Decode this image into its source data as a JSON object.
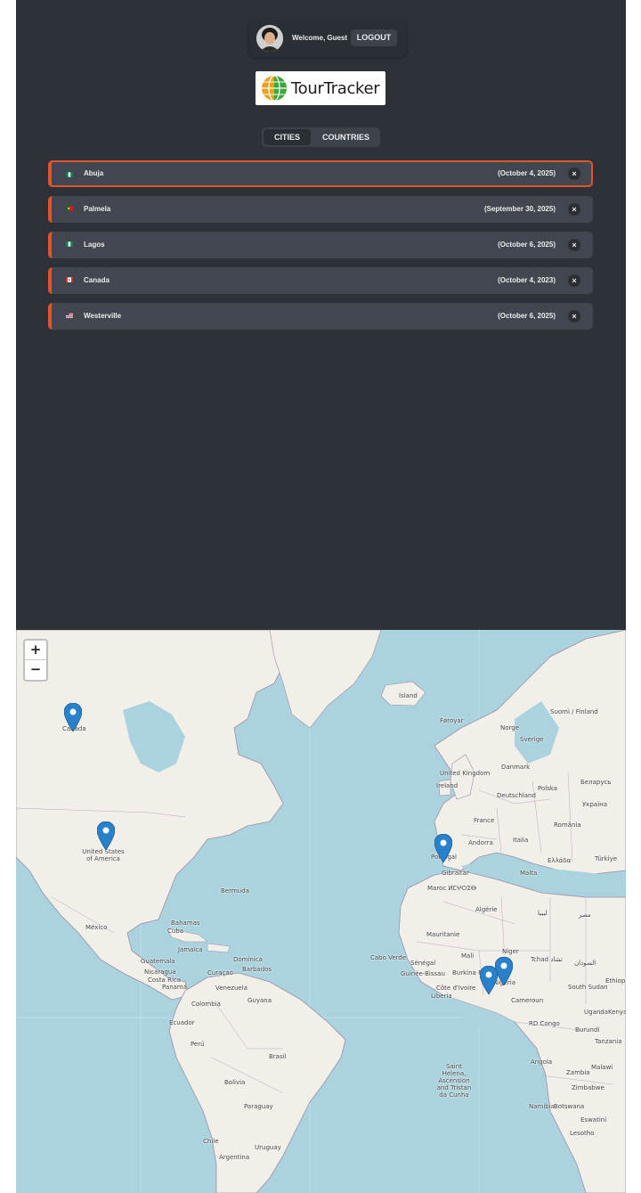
{
  "header": {
    "welcome": "Welcome, Guest",
    "logout_label": "LOGOUT"
  },
  "logo": {
    "text": "TourTracker"
  },
  "tabs": [
    {
      "label": "CITIES",
      "active": true
    },
    {
      "label": "COUNTRIES",
      "active": false
    }
  ],
  "cities": [
    {
      "name": "Abuja",
      "date": "(October 4, 2025)",
      "flag": "nigeria",
      "active": true
    },
    {
      "name": "Palmela",
      "date": "(September 30, 2025)",
      "flag": "portugal",
      "active": false
    },
    {
      "name": "Lagos",
      "date": "(October 6, 2025)",
      "flag": "nigeria",
      "active": false
    },
    {
      "name": "Canada",
      "date": "(October 4, 2023)",
      "flag": "canada",
      "active": false
    },
    {
      "name": "Westerville",
      "date": "(October 6, 2025)",
      "flag": "usa",
      "active": false
    }
  ],
  "delete_symbol": "×",
  "map": {
    "zoom_in": "+",
    "zoom_out": "−",
    "labels": {
      "island": "Ísland",
      "faroyar": "Føroyar",
      "suomi": "Suomi / Finland",
      "norge": "Norge",
      "sverige": "Sverige",
      "uk": "United Kingdom",
      "ireland": "Ireland",
      "france": "France",
      "espana": "España",
      "portugal": "Portugal",
      "andorra": "Andorra",
      "italia": "Italia",
      "gibraltar": "Gibraltar",
      "maroc": "Maroc ⵍⵎⵖⵔⵉⴱ",
      "algerie": "Algérie",
      "libya": "ليبيا",
      "misr": "مصر",
      "mali": "Mali",
      "niger": "Niger",
      "tchad": "Tchad تشاد",
      "sudan": "السودان",
      "mauritanie": "Mauritanie",
      "cabo_verde": "Cabo Verde",
      "senegal": "Sénégal",
      "nigeria": "Nigeria",
      "cameroun": "Cameroun",
      "angola": "Angola",
      "namibia": "Namibia",
      "saint_helena": "Saint Helena, Ascension and Tristan da Cunha",
      "canada": "Canada",
      "usa": "United States of America",
      "mexico": "México",
      "cuba": "Cuba",
      "bermuda": "Bermuda",
      "venezuela": "Venezuela",
      "colombia": "Colombia",
      "ecuador": "Ecuador",
      "peru": "Perú",
      "brasil": "Brasil",
      "bolivia": "Bolivia",
      "paraguay": "Paraguay",
      "chile": "Chile",
      "argentina": "Argentina",
      "uruguay": "Uruguay",
      "guyana": "Guyana",
      "turkiye": "Türkiye",
      "ethiopia": "Ethiopia",
      "kenya": "Kenya",
      "tanzania": "Tanzania",
      "zambia": "Zambia",
      "zimbabwe": "Zimbabwe",
      "botswana": "Botswana",
      "lesotho": "Lesotho",
      "south_sudan": "South Sudan",
      "uganda": "Uganda",
      "burundi": "Burundi",
      "malawi": "Malawi",
      "eswatini": "Eswatini",
      "polska": "Polska",
      "deutschland": "Deutschland",
      "danmark": "Danmark",
      "ukraine": "Україна",
      "belarus": "Беларусь",
      "romania": "România",
      "greece": "Ελλάδα",
      "malta": "Malta",
      "bahamas": "Bahamas",
      "jamaica": "Jamaica",
      "panama": "Panamá",
      "guatemala": "Guatemala",
      "nicaragua": "Nicaragua",
      "costa_rica": "Costa Rica",
      "barbados": "Barbados",
      "dominica": "Dominica",
      "curacao": "Curaçao",
      "rdc": "RD Congo",
      "liberia": "Liberia",
      "cote_divoire": "Côte d'Ivoire",
      "burkina": "Burkina Faso",
      "guinee": "Guinée-Bissau"
    }
  },
  "colors": {
    "accent": "#e0562a",
    "panel_bg": "#2d3238",
    "card_bg": "#42474f",
    "water": "#aad3df",
    "land": "#f2efe9",
    "marker": "#2a81cb"
  }
}
